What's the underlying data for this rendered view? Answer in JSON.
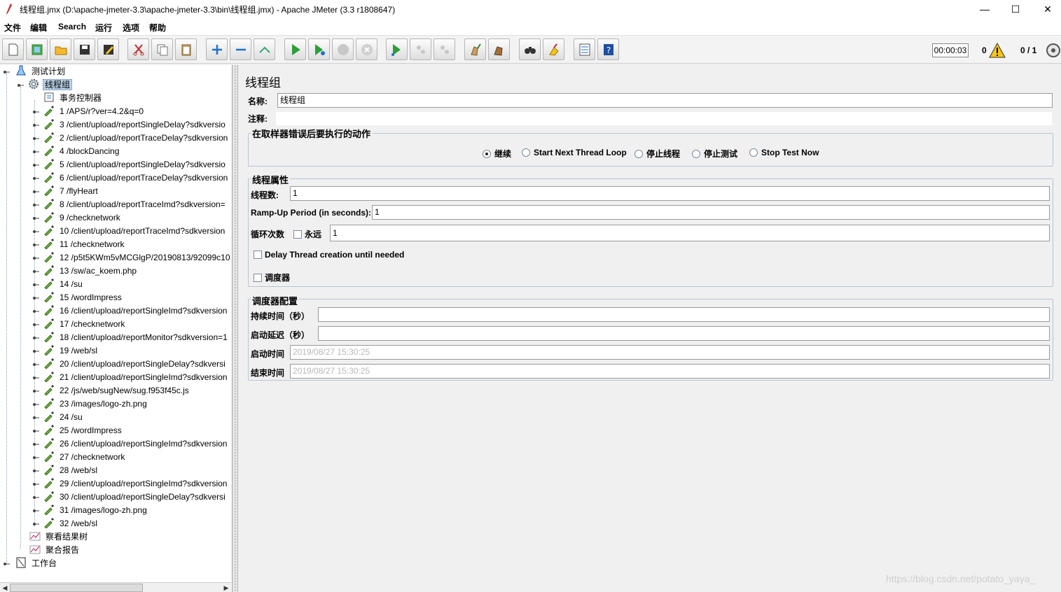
{
  "window": {
    "title": "线程组.jmx (D:\\apache-jmeter-3.3\\apache-jmeter-3.3\\bin\\线程组.jmx) - Apache JMeter (3.3 r1808647)",
    "controls": {
      "minimize": "—",
      "maximize": "☐",
      "close": "✕"
    }
  },
  "menubar": [
    "文件",
    "编辑",
    "Search",
    "运行",
    "选项",
    "帮助"
  ],
  "toolbar": {
    "timer": "00:00:03",
    "warning_count": "0",
    "thread_count": "0 / 1",
    "buttons": [
      "new",
      "templates",
      "open",
      "save",
      "save-as",
      "cut",
      "copy",
      "paste",
      "expand",
      "collapse",
      "toggle",
      "start",
      "start-no-timers",
      "stop",
      "shutdown",
      "remote-start",
      "remote-stop",
      "remote-exit",
      "clear",
      "clear-all",
      "search",
      "reset-search",
      "function-helper",
      "help"
    ]
  },
  "tree": {
    "root": "测试计划",
    "thread_group": "线程组",
    "controller": "事务控制器",
    "samplers": [
      "1 /APS/r?ver=4.2&q=0",
      "3 /client/upload/reportSingleDelay?sdkversio",
      "2 /client/upload/reportTraceDelay?sdkversion",
      "4 /blockDancing",
      "5 /client/upload/reportSingleDelay?sdkversio",
      "6 /client/upload/reportTraceDelay?sdkversion",
      "7 /flyHeart",
      "8 /client/upload/reportTraceImd?sdkversion=",
      "9 /checknetwork",
      "10 /client/upload/reportTraceImd?sdkversion",
      "11 /checknetwork",
      "12 /p5t5KWm5vMCGlgP/20190813/92099c10",
      "13 /sw/ac_koem.php",
      "14 /su",
      "15 /wordImpress",
      "16 /client/upload/reportSingleImd?sdkversion",
      "17 /checknetwork",
      "18 /client/upload/reportMonitor?sdkversion=1",
      "19 /web/sl",
      "20 /client/upload/reportSingleDelay?sdkversi",
      "21 /client/upload/reportSingleImd?sdkversion",
      "22 /js/web/sugNew/sug.f953f45c.js",
      "23 /images/logo-zh.png",
      "24 /su",
      "25 /wordImpress",
      "26 /client/upload/reportSingleImd?sdkversion",
      "27 /checknetwork",
      "28 /web/sl",
      "29 /client/upload/reportSingleImd?sdkversion",
      "30 /client/upload/reportSingleDelay?sdkversi",
      "31 /images/logo-zh.png",
      "32 /web/sl"
    ],
    "listeners": [
      "察看结果树",
      "聚合报告"
    ],
    "workbench": "工作台"
  },
  "panel": {
    "heading": "线程组",
    "name_label": "名称:",
    "name_value": "线程组",
    "comment_label": "注释:",
    "comment_value": "",
    "on_error": {
      "title": "在取样器错误后要执行的动作",
      "options": [
        "继续",
        "Start Next Thread Loop",
        "停止线程",
        "停止测试",
        "Stop Test Now"
      ],
      "selected": "继续"
    },
    "thread_props": {
      "title": "线程属性",
      "threads_label": "线程数:",
      "threads_value": "1",
      "rampup_label": "Ramp-Up Period (in seconds):",
      "rampup_value": "1",
      "loop_label": "循环次数",
      "forever_label": "永远",
      "forever_checked": false,
      "loop_value": "1",
      "delay_label": "Delay Thread creation until needed",
      "delay_checked": false,
      "scheduler_label": "调度器",
      "scheduler_checked": false
    },
    "scheduler": {
      "title": "调度器配置",
      "duration_label": "持续时间（秒）",
      "duration_value": "",
      "startup_delay_label": "启动延迟（秒）",
      "startup_delay_value": "",
      "start_time_label": "启动时间",
      "start_time_value": "2019/08/27 15:30:25",
      "end_time_label": "结束时间",
      "end_time_value": "2019/08/27 15:30:25"
    }
  },
  "watermark": "https://blog.csdn.net/potato_yaya_"
}
